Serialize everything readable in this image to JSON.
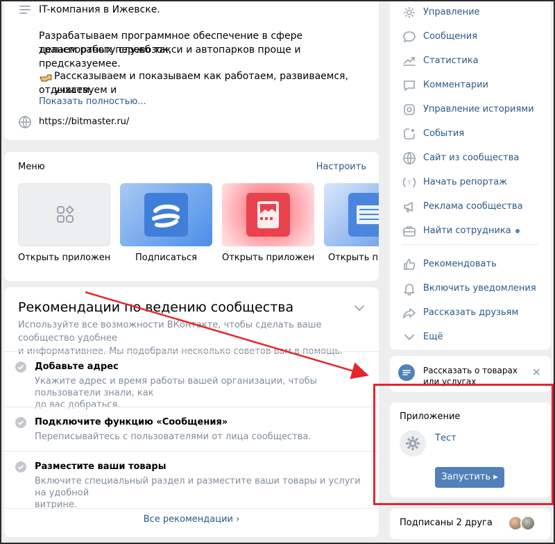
{
  "about": {
    "description": "IT-компания в Ижевске.",
    "line2": "Разрабатываем программное обеспечение в сфере транспортных перевозок,",
    "line3": "делаем работу служб такси и автопарков проще и предсказуемее.",
    "line4": "Рассказываем и показываем как работаем, развиваемся, участвуем и",
    "line5": "отдыхаем.",
    "show_more": "Показать полностью...",
    "website": "https://bitmaster.ru/"
  },
  "menu": {
    "title": "Меню",
    "setup_link": "Настроить",
    "tiles": [
      {
        "label": "Открыть приложен..."
      },
      {
        "label": "Подписаться"
      },
      {
        "label": "Открыть приложен..."
      },
      {
        "label": "Открыть прил"
      }
    ]
  },
  "recommendations": {
    "heading": "Рекомендации по ведению сообщества",
    "sub1": "Используйте все возможности ВКонтакте, чтобы сделать ваше сообщество удобнее",
    "sub2": "и информативнее. Мы подобрали несколько советов вам в помощь.",
    "items": [
      {
        "title": "Добавьте адрес",
        "text1": "Укажите адрес и время работы вашей организации, чтобы пользователи знали, как",
        "text2": "до вас добраться."
      },
      {
        "title": "Подключите функцию «Сообщения»",
        "text1": "Переписывайтесь с пользователями от лица сообщества.",
        "text2": ""
      },
      {
        "title": "Разместите ваши товары",
        "text1": "Включите специальный раздел и разместите ваши товары и услуги на удобной",
        "text2": "витрине."
      }
    ],
    "all_link": "Все рекомендации ›"
  },
  "nav": {
    "items": [
      {
        "label": "Управление",
        "icon": "gear-icon"
      },
      {
        "label": "Сообщения",
        "icon": "message-icon"
      },
      {
        "label": "Статистика",
        "icon": "stats-icon"
      },
      {
        "label": "Комментарии",
        "icon": "comment-icon"
      },
      {
        "label": "Управление историями",
        "icon": "stories-icon"
      },
      {
        "label": "События",
        "icon": "event-icon"
      },
      {
        "label": "Сайт из сообщества",
        "icon": "globe-icon"
      },
      {
        "label": "Начать репортаж",
        "icon": "live-icon"
      },
      {
        "label": "Реклама сообщества",
        "icon": "megaphone-icon"
      },
      {
        "label": "Найти сотрудника",
        "icon": "briefcase-icon"
      }
    ],
    "items2": [
      {
        "label": "Рекомендовать",
        "icon": "thumb-up-icon"
      },
      {
        "label": "Включить уведомления",
        "icon": "bell-icon"
      },
      {
        "label": "Рассказать друзьям",
        "icon": "share-icon"
      },
      {
        "label": "Ещё",
        "icon": "chevron-down-icon"
      }
    ]
  },
  "promo": {
    "text": "Рассказать о товарах или услугах",
    "close": "✕"
  },
  "app": {
    "title": "Приложение",
    "name": "Тест",
    "launch": "Запустить ▸"
  },
  "friends": {
    "text": "Подписаны 2 друга"
  }
}
